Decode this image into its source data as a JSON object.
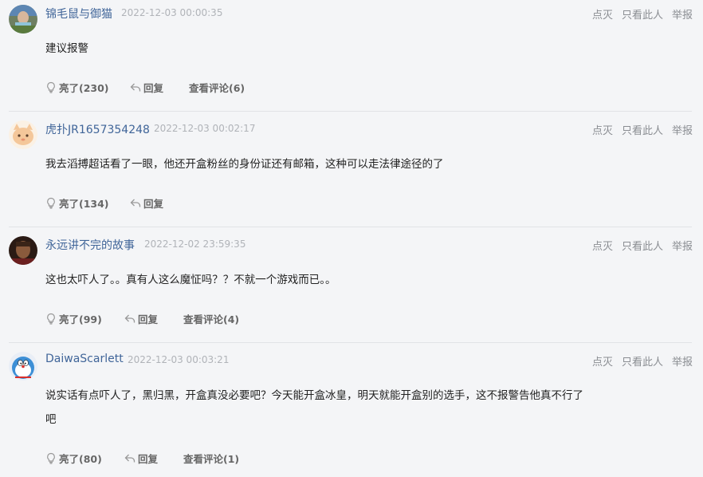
{
  "top_actions": [
    "点灭",
    "只看此人",
    "举报"
  ],
  "comments": [
    {
      "username": "锦毛鼠与御猫",
      "time": "2022-12-03 00:00:35",
      "text": "建议报警",
      "like_label": "亮了(230)",
      "reply_label": "回复",
      "view_label": "查看评论(6)"
    },
    {
      "username": "虎扑JR1657354248",
      "time": "2022-12-03 00:02:17",
      "text": "我去滔搏超话看了一眼，他还开盒粉丝的身份证还有邮箱，这种可以走法律途径的了",
      "like_label": "亮了(134)",
      "reply_label": "回复"
    },
    {
      "username": "永远讲不完的故事",
      "time": "2022-12-02 23:59:35",
      "text": "这也太吓人了。。真有人这么魔怔吗？？不就一个游戏而已。。",
      "like_label": "亮了(99)",
      "reply_label": "回复",
      "view_label": "查看评论(4)"
    },
    {
      "username": "DaiwaScarlett",
      "time": "2022-12-03 00:03:21",
      "text": "说实话有点吓人了，黑归黑，开盒真没必要吧？今天能开盒冰皇，明天就能开盒别的选手，这不报警告他真不行了吧",
      "like_label": "亮了(80)",
      "reply_label": "回复",
      "view_label": "查看评论(1)"
    }
  ],
  "colors": {
    "username": "#406599",
    "background": "#f4f5f7",
    "divider": "#e1e3e6"
  }
}
